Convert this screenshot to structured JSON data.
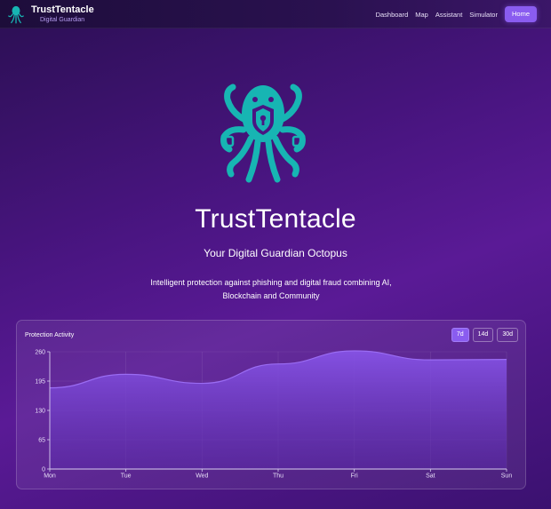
{
  "app": {
    "brand_name": "TrustTentacle",
    "brand_tagline": "Digital Guardian",
    "logo_icon": "octopus-shield-icon",
    "accent_color": "#8a5cf0",
    "logo_color": "#17b5b3"
  },
  "nav": {
    "links": [
      "Dashboard",
      "Map",
      "Assistant",
      "Simulator"
    ],
    "home_label": "Home"
  },
  "hero": {
    "title": "TrustTentacle",
    "subtitle": "Your Digital Guardian Octopus",
    "description": "Intelligent protection against phishing and digital fraud combining AI, Blockchain and Community"
  },
  "activity_card": {
    "title": "Protection Activity",
    "ranges": [
      "7d",
      "14d",
      "30d"
    ],
    "selected_range": "7d"
  },
  "chart_data": {
    "type": "area",
    "title": "Protection Activity",
    "categories": [
      "Mon",
      "Tue",
      "Wed",
      "Thu",
      "Fri",
      "Sat",
      "Sun"
    ],
    "values": [
      180,
      210,
      190,
      233,
      262,
      242,
      243
    ],
    "yticks": [
      0,
      65,
      130,
      195,
      260
    ],
    "ylim": [
      0,
      260
    ],
    "fill_color": "#7c4ddf",
    "grid": true
  }
}
